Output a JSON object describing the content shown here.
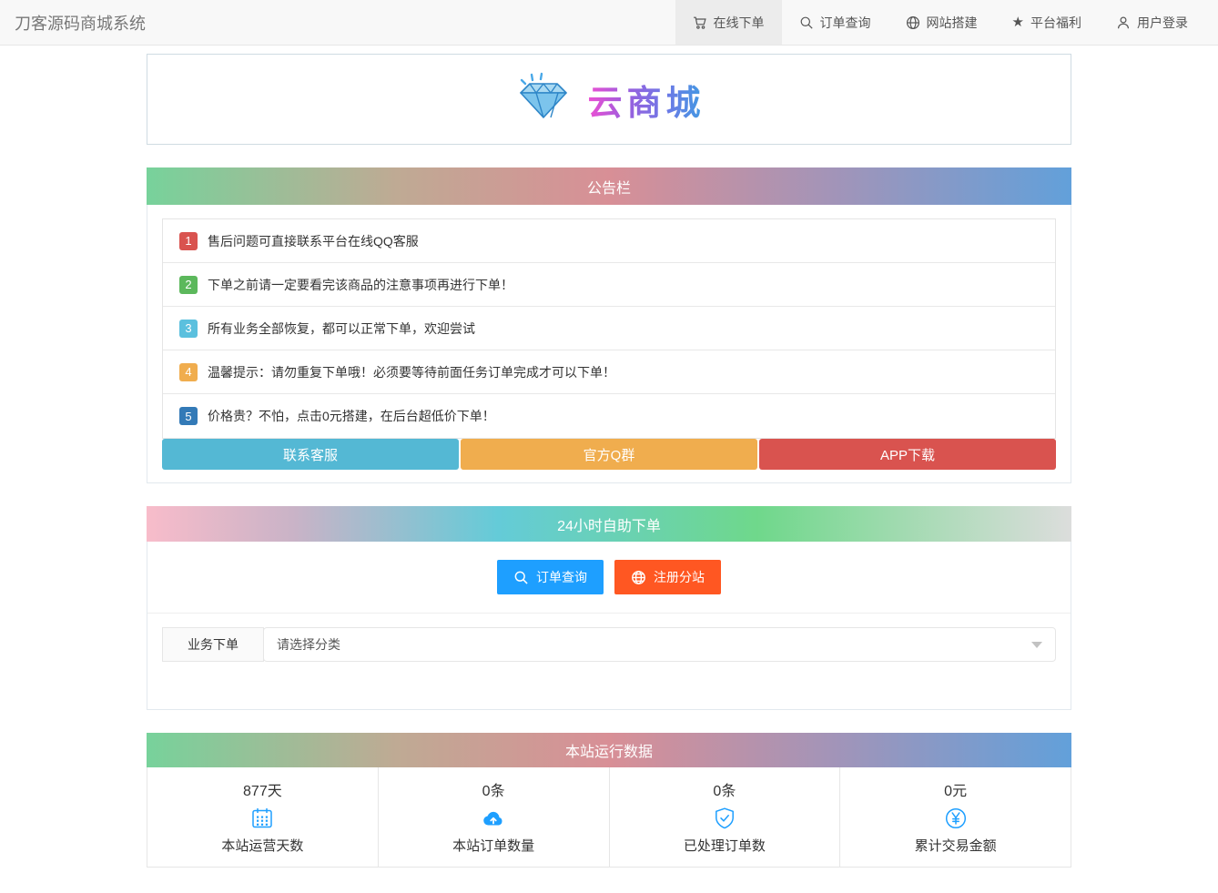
{
  "navbar": {
    "brand": "刀客源码商城系统",
    "items": [
      {
        "label": "在线下单",
        "icon": "cart-icon",
        "active": true
      },
      {
        "label": "订单查询",
        "icon": "search-icon",
        "active": false
      },
      {
        "label": "网站搭建",
        "icon": "globe-icon",
        "active": false
      },
      {
        "label": "平台福利",
        "icon": "star-icon",
        "active": false
      },
      {
        "label": "用户登录",
        "icon": "user-icon",
        "active": false
      }
    ]
  },
  "logo": {
    "icon": "diamond-icon",
    "text": "云商城"
  },
  "announcement": {
    "title": "公告栏",
    "items": [
      {
        "num": "1",
        "text": "售后问题可直接联系平台在线QQ客服",
        "badge_color": "#d9534f"
      },
      {
        "num": "2",
        "text": "下单之前请一定要看完该商品的注意事项再进行下单！",
        "badge_color": "#5cb85c"
      },
      {
        "num": "3",
        "text": "所有业务全部恢复，都可以正常下单，欢迎尝试",
        "badge_color": "#5bc0de"
      },
      {
        "num": "4",
        "text": "温馨提示：请勿重复下单哦！必须要等待前面任务订单完成才可以下单！",
        "badge_color": "#f0ad4e"
      },
      {
        "num": "5",
        "text": "价格贵？不怕，点击0元搭建，在后台超低价下单！",
        "badge_color": "#337ab7"
      }
    ],
    "buttons": [
      {
        "label": "联系客服",
        "color": "#54b8d4"
      },
      {
        "label": "官方Q群",
        "color": "#f0ad4e"
      },
      {
        "label": "APP下载",
        "color": "#d9534f"
      }
    ]
  },
  "selfservice": {
    "title": "24小时自助下单",
    "buttons": [
      {
        "label": "订单查询",
        "icon": "search-icon",
        "color": "#1E9FFF"
      },
      {
        "label": "注册分站",
        "icon": "globe-icon",
        "color": "#FF5722"
      }
    ],
    "form": {
      "label": "业务下单",
      "select_placeholder": "请选择分类"
    }
  },
  "stats": {
    "title": "本站运行数据",
    "icon_color": "#1E9FFF",
    "items": [
      {
        "value": "877天",
        "icon": "calendar-icon",
        "label": "本站运营天数"
      },
      {
        "value": "0条",
        "icon": "cloud-upload-icon",
        "label": "本站订单数量"
      },
      {
        "value": "0条",
        "icon": "shield-check-icon",
        "label": "已处理订单数"
      },
      {
        "value": "0元",
        "icon": "yen-circle-icon",
        "label": "累计交易金额"
      }
    ]
  }
}
